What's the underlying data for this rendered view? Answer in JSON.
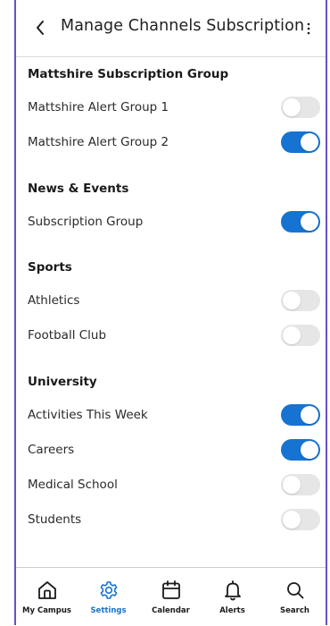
{
  "header": {
    "title": "Manage Channels Subscription"
  },
  "colors": {
    "accent": "#1673d1",
    "frame": "#6a4fc4",
    "toggle_off": "#e6e6e6"
  },
  "sections": [
    {
      "title": "Mattshire Subscription Group",
      "items": [
        {
          "label": "Mattshire Alert Group 1",
          "on": false
        },
        {
          "label": "Mattshire Alert Group 2",
          "on": true
        }
      ]
    },
    {
      "title": "News & Events",
      "items": [
        {
          "label": "Subscription Group",
          "on": true
        }
      ]
    },
    {
      "title": "Sports",
      "items": [
        {
          "label": "Athletics",
          "on": false
        },
        {
          "label": "Football Club",
          "on": false
        }
      ]
    },
    {
      "title": "University",
      "items": [
        {
          "label": "Activities This Week",
          "on": true
        },
        {
          "label": "Careers",
          "on": true
        },
        {
          "label": "Medical School",
          "on": false
        },
        {
          "label": "Students",
          "on": false
        }
      ]
    }
  ],
  "tabs": [
    {
      "label": "My Campus",
      "icon": "home-icon",
      "active": false
    },
    {
      "label": "Settings",
      "icon": "gear-icon",
      "active": true
    },
    {
      "label": "Calendar",
      "icon": "calendar-icon",
      "active": false
    },
    {
      "label": "Alerts",
      "icon": "bell-icon",
      "active": false
    },
    {
      "label": "Search",
      "icon": "search-icon",
      "active": false
    }
  ]
}
